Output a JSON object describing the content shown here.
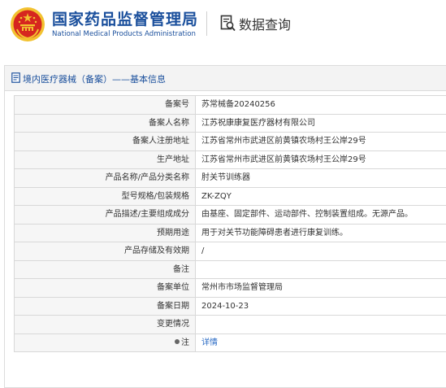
{
  "header": {
    "org_cn": "国家药品监督管理局",
    "org_en": "National Medical Products Administration",
    "query_label": "数据查询",
    "icons": {
      "emblem": "national-emblem",
      "query": "document-search-icon"
    },
    "colors": {
      "brand": "#1a4f9c",
      "emblem_red": "#d6261f",
      "emblem_gold": "#f2c230"
    }
  },
  "panel": {
    "title": "境内医疗器械（备案）——基本信息",
    "icon": "document-icon"
  },
  "rows": [
    {
      "label": "备案号",
      "value": "苏常械备20240256"
    },
    {
      "label": "备案人名称",
      "value": "江苏祝康康复医疗器材有限公司"
    },
    {
      "label": "备案人注册地址",
      "value": "江苏省常州市武进区前黄镇农场村王公岸29号"
    },
    {
      "label": "生产地址",
      "value": "江苏省常州市武进区前黄镇农场村王公岸29号"
    },
    {
      "label": "产品名称/产品分类名称",
      "value": "肘关节训练器"
    },
    {
      "label": "型号规格/包装规格",
      "value": "ZK-ZQY"
    },
    {
      "label": "产品描述/主要组成成分",
      "value": "由基座、固定部件、运动部件、控制装置组成。无源产品。"
    },
    {
      "label": "预期用途",
      "value": "用于对关节功能障碍患者进行康复训练。"
    },
    {
      "label": "产品存储及有效期",
      "value": "/"
    },
    {
      "label": "备注",
      "value": ""
    },
    {
      "label": "备案单位",
      "value": "常州市市场监督管理局"
    },
    {
      "label": "备案日期",
      "value": "2024-10-23"
    },
    {
      "label": "变更情况",
      "value": ""
    }
  ],
  "note_row": {
    "label": "注",
    "link_text": "详情",
    "icon": "pin-icon",
    "link_color": "#2a6bc4"
  }
}
